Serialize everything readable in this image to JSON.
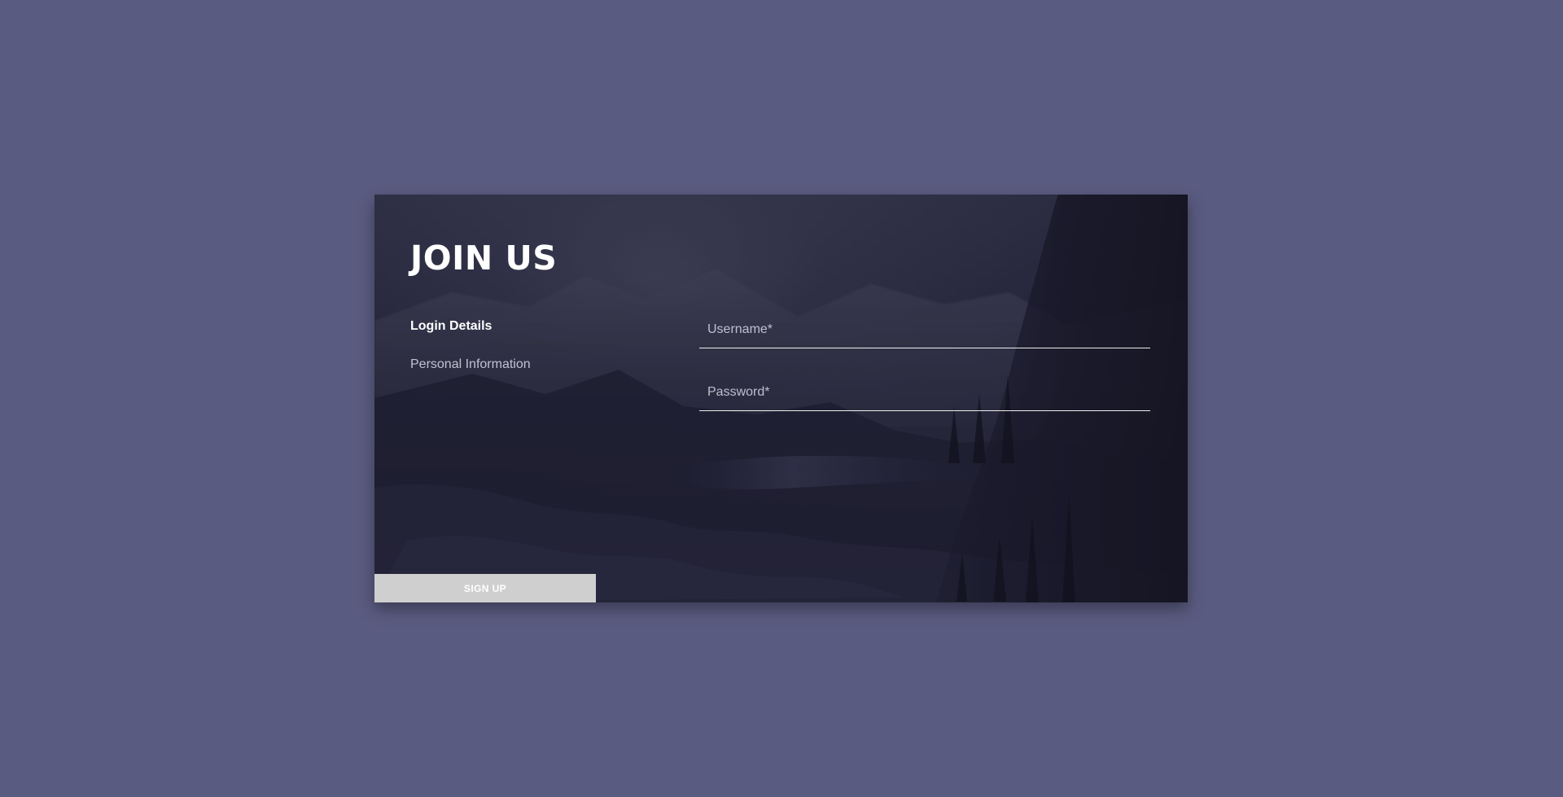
{
  "page": {
    "background_color": "#5a5b80"
  },
  "card": {
    "title": "JOIN US",
    "nav": {
      "items": [
        {
          "label": "Login Details",
          "active": true
        },
        {
          "label": "Personal Information",
          "active": false
        }
      ]
    },
    "fields": {
      "username": {
        "placeholder": "Username*",
        "value": ""
      },
      "password": {
        "placeholder": "Password*",
        "value": ""
      }
    },
    "buttons": {
      "signup_label": "SIGN UP"
    }
  },
  "icons": []
}
